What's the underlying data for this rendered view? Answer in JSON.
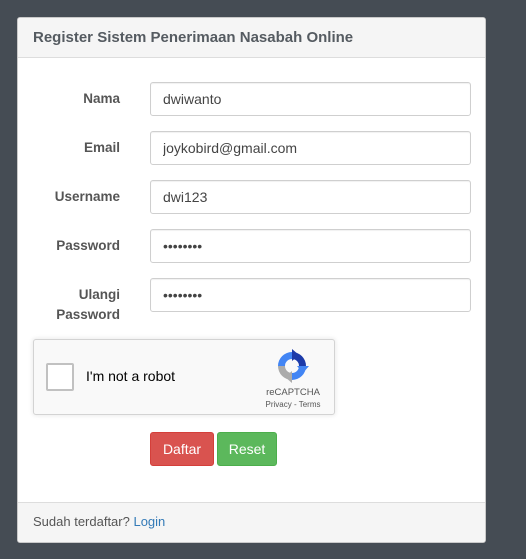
{
  "panel": {
    "title": "Register Sistem Penerimaan Nasabah Online"
  },
  "form": {
    "nama": {
      "label": "Nama",
      "value": "dwiwanto"
    },
    "email": {
      "label": "Email",
      "value": "joykobird@gmail.com"
    },
    "username": {
      "label": "Username",
      "value": "dwi123"
    },
    "password": {
      "label": "Password",
      "value": "dwi12345"
    },
    "ulangi_password": {
      "label_line1": "Ulangi",
      "label_line2": "Password",
      "value": "dwi12345"
    }
  },
  "captcha": {
    "label": "I'm not a robot",
    "brand": "reCAPTCHA",
    "privacy": "Privacy",
    "separator": " - ",
    "terms": "Terms",
    "logo_icon": "recaptcha-logo-icon"
  },
  "buttons": {
    "daftar_label": "Daftar",
    "reset_label": "Reset"
  },
  "footer": {
    "text": "Sudah terdaftar? ",
    "login_link": "Login"
  },
  "colors": {
    "background": "#454c54",
    "danger": "#d9534f",
    "success": "#5cb85c",
    "link": "#337ab7"
  }
}
